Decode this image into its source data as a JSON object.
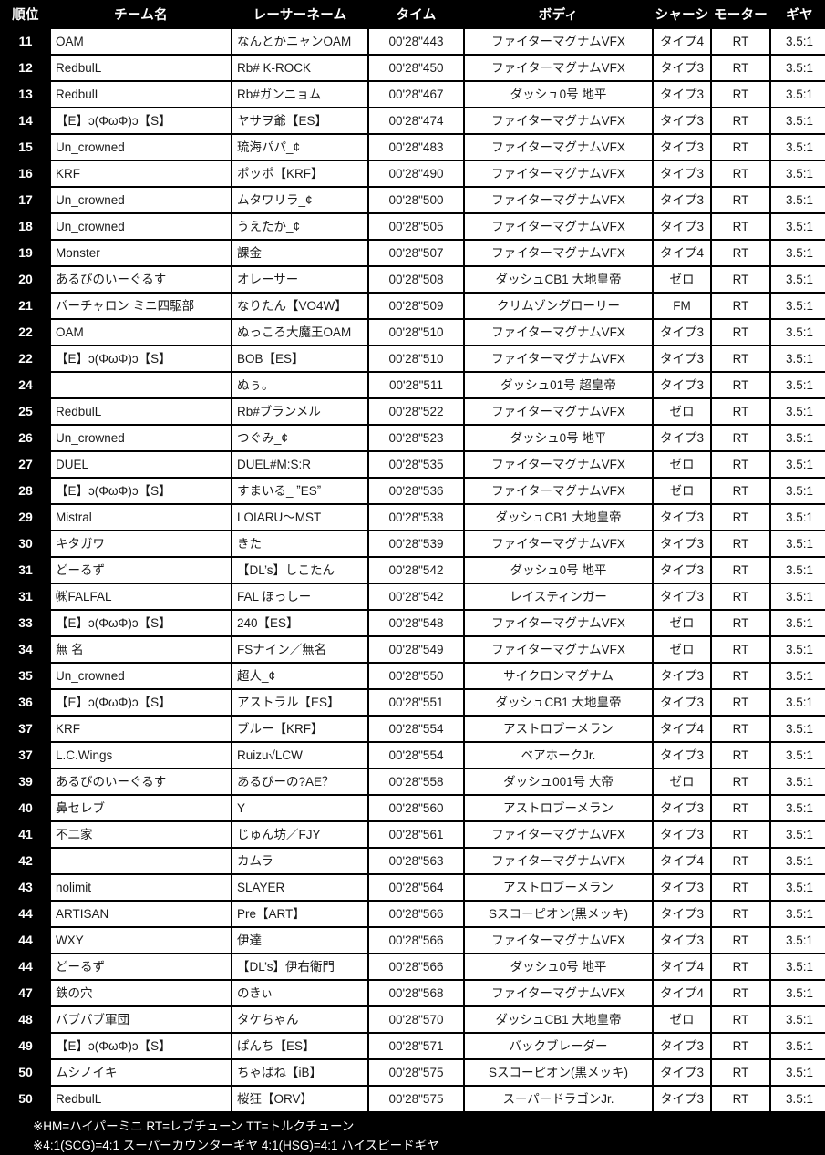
{
  "table": {
    "headers": {
      "rank": "順位",
      "team": "チーム名",
      "racer": "レーサーネーム",
      "time": "タイム",
      "body": "ボディ",
      "chassis": "シャーシ",
      "motor": "モーター",
      "gear": "ギヤ"
    },
    "rows": [
      {
        "rank": "11",
        "team": "OAM",
        "racer": "なんとかニャンOAM",
        "time": "00'28\"443",
        "body": "ファイターマグナムVFX",
        "chassis": "タイプ4",
        "motor": "RT",
        "gear": "3.5:1"
      },
      {
        "rank": "12",
        "team": "RedbulL",
        "racer": "Rb# K-ROCK",
        "time": "00'28\"450",
        "body": "ファイターマグナムVFX",
        "chassis": "タイプ3",
        "motor": "RT",
        "gear": "3.5:1"
      },
      {
        "rank": "13",
        "team": "RedbulL",
        "racer": "Rb#ガンニョム",
        "time": "00'28\"467",
        "body": "ダッシュ0号 地平",
        "chassis": "タイプ3",
        "motor": "RT",
        "gear": "3.5:1"
      },
      {
        "rank": "14",
        "team": "【E】ɔ(ΦωΦ)ɔ【S】",
        "racer": "ヤサヲ爺【ES】",
        "time": "00'28\"474",
        "body": "ファイターマグナムVFX",
        "chassis": "タイプ3",
        "motor": "RT",
        "gear": "3.5:1"
      },
      {
        "rank": "15",
        "team": "Un_crowned",
        "racer": "琉海パパ_¢",
        "time": "00'28\"483",
        "body": "ファイターマグナムVFX",
        "chassis": "タイプ3",
        "motor": "RT",
        "gear": "3.5:1"
      },
      {
        "rank": "16",
        "team": "KRF",
        "racer": "ポッポ【KRF】",
        "time": "00'28\"490",
        "body": "ファイターマグナムVFX",
        "chassis": "タイプ3",
        "motor": "RT",
        "gear": "3.5:1"
      },
      {
        "rank": "17",
        "team": "Un_crowned",
        "racer": "ムタワリラ_¢",
        "time": "00'28\"500",
        "body": "ファイターマグナムVFX",
        "chassis": "タイプ3",
        "motor": "RT",
        "gear": "3.5:1"
      },
      {
        "rank": "18",
        "team": "Un_crowned",
        "racer": "うえたか_¢",
        "time": "00'28\"505",
        "body": "ファイターマグナムVFX",
        "chassis": "タイプ3",
        "motor": "RT",
        "gear": "3.5:1"
      },
      {
        "rank": "19",
        "team": "Monster",
        "racer": "課金",
        "time": "00'28\"507",
        "body": "ファイターマグナムVFX",
        "chassis": "タイプ4",
        "motor": "RT",
        "gear": "3.5:1"
      },
      {
        "rank": "20",
        "team": "あるびのいーぐるす",
        "racer": "オレーサー",
        "time": "00'28\"508",
        "body": "ダッシュCB1 大地皇帝",
        "chassis": "ゼロ",
        "motor": "RT",
        "gear": "3.5:1"
      },
      {
        "rank": "21",
        "team": "バーチャロン ミニ四駆部",
        "racer": "なりたん【VO4W】",
        "time": "00'28\"509",
        "body": "クリムゾングローリー",
        "chassis": "FM",
        "motor": "RT",
        "gear": "3.5:1"
      },
      {
        "rank": "22",
        "team": "OAM",
        "racer": "ぬっころ大魔王OAM",
        "time": "00'28\"510",
        "body": "ファイターマグナムVFX",
        "chassis": "タイプ3",
        "motor": "RT",
        "gear": "3.5:1"
      },
      {
        "rank": "22",
        "team": "【E】ɔ(ΦωΦ)ɔ【S】",
        "racer": "BOB【ES】",
        "time": "00'28\"510",
        "body": "ファイターマグナムVFX",
        "chassis": "タイプ3",
        "motor": "RT",
        "gear": "3.5:1"
      },
      {
        "rank": "24",
        "team": "",
        "racer": "ぬぅ。",
        "time": "00'28\"511",
        "body": "ダッシュ01号 超皇帝",
        "chassis": "タイプ3",
        "motor": "RT",
        "gear": "3.5:1"
      },
      {
        "rank": "25",
        "team": "RedbulL",
        "racer": "Rb#ブランメル",
        "time": "00'28\"522",
        "body": "ファイターマグナムVFX",
        "chassis": "ゼロ",
        "motor": "RT",
        "gear": "3.5:1"
      },
      {
        "rank": "26",
        "team": "Un_crowned",
        "racer": "つぐみ_¢",
        "time": "00'28\"523",
        "body": "ダッシュ0号 地平",
        "chassis": "タイプ3",
        "motor": "RT",
        "gear": "3.5:1"
      },
      {
        "rank": "27",
        "team": "DUEL",
        "racer": "DUEL#M:S:R",
        "time": "00'28\"535",
        "body": "ファイターマグナムVFX",
        "chassis": "ゼロ",
        "motor": "RT",
        "gear": "3.5:1"
      },
      {
        "rank": "28",
        "team": "【E】ɔ(ΦωΦ)ɔ【S】",
        "racer": "すまいる_ ˮESˮ",
        "time": "00'28\"536",
        "body": "ファイターマグナムVFX",
        "chassis": "ゼロ",
        "motor": "RT",
        "gear": "3.5:1"
      },
      {
        "rank": "29",
        "team": "Mistral",
        "racer": "LOIARU〜MST",
        "time": "00'28\"538",
        "body": "ダッシュCB1 大地皇帝",
        "chassis": "タイプ3",
        "motor": "RT",
        "gear": "3.5:1"
      },
      {
        "rank": "30",
        "team": "キタガワ",
        "racer": "きた",
        "time": "00'28\"539",
        "body": "ファイターマグナムVFX",
        "chassis": "タイプ3",
        "motor": "RT",
        "gear": "3.5:1"
      },
      {
        "rank": "31",
        "team": "どーるず",
        "racer": "【DL’s】しこたん",
        "time": "00'28\"542",
        "body": "ダッシュ0号 地平",
        "chassis": "タイプ3",
        "motor": "RT",
        "gear": "3.5:1"
      },
      {
        "rank": "31",
        "team": "㈱FALFAL",
        "racer": "FAL ほっしー",
        "time": "00'28\"542",
        "body": "レイスティンガー",
        "chassis": "タイプ3",
        "motor": "RT",
        "gear": "3.5:1"
      },
      {
        "rank": "33",
        "team": "【E】ɔ(ΦωΦ)ɔ【S】",
        "racer": "240【ES】",
        "time": "00'28\"548",
        "body": "ファイターマグナムVFX",
        "chassis": "ゼロ",
        "motor": "RT",
        "gear": "3.5:1"
      },
      {
        "rank": "34",
        "team": "無 名",
        "racer": "FSナイン／無名",
        "time": "00'28\"549",
        "body": "ファイターマグナムVFX",
        "chassis": "ゼロ",
        "motor": "RT",
        "gear": "3.5:1"
      },
      {
        "rank": "35",
        "team": "Un_crowned",
        "racer": "超人_¢",
        "time": "00'28\"550",
        "body": "サイクロンマグナム",
        "chassis": "タイプ3",
        "motor": "RT",
        "gear": "3.5:1"
      },
      {
        "rank": "36",
        "team": "【E】ɔ(ΦωΦ)ɔ【S】",
        "racer": "アストラル【ES】",
        "time": "00'28\"551",
        "body": "ダッシュCB1 大地皇帝",
        "chassis": "タイプ3",
        "motor": "RT",
        "gear": "3.5:1"
      },
      {
        "rank": "37",
        "team": "KRF",
        "racer": "ブルー【KRF】",
        "time": "00'28\"554",
        "body": "アストロブーメラン",
        "chassis": "タイプ4",
        "motor": "RT",
        "gear": "3.5:1"
      },
      {
        "rank": "37",
        "team": "L.C.Wings",
        "racer": "Ruizu√LCW",
        "time": "00'28\"554",
        "body": "ベアホークJr.",
        "chassis": "タイプ3",
        "motor": "RT",
        "gear": "3.5:1"
      },
      {
        "rank": "39",
        "team": "あるびのいーぐるす",
        "racer": "あるびーの?AE？",
        "time": "00'28\"558",
        "body": "ダッシュ001号 大帝",
        "chassis": "ゼロ",
        "motor": "RT",
        "gear": "3.5:1"
      },
      {
        "rank": "40",
        "team": "鼻セレブ",
        "racer": "Y",
        "time": "00'28\"560",
        "body": "アストロブーメラン",
        "chassis": "タイプ3",
        "motor": "RT",
        "gear": "3.5:1"
      },
      {
        "rank": "41",
        "team": "不二家",
        "racer": "じゅん坊／FJY",
        "time": "00'28\"561",
        "body": "ファイターマグナムVFX",
        "chassis": "タイプ3",
        "motor": "RT",
        "gear": "3.5:1"
      },
      {
        "rank": "42",
        "team": "",
        "racer": "カムラ",
        "time": "00'28\"563",
        "body": "ファイターマグナムVFX",
        "chassis": "タイプ4",
        "motor": "RT",
        "gear": "3.5:1"
      },
      {
        "rank": "43",
        "team": "nolimit",
        "racer": "SLAYER",
        "time": "00'28\"564",
        "body": "アストロブーメラン",
        "chassis": "タイプ3",
        "motor": "RT",
        "gear": "3.5:1"
      },
      {
        "rank": "44",
        "team": "ARTISAN",
        "racer": "Pre【ART】",
        "time": "00'28\"566",
        "body": "Sスコーピオン(黒メッキ)",
        "chassis": "タイプ3",
        "motor": "RT",
        "gear": "3.5:1"
      },
      {
        "rank": "44",
        "team": "WXY",
        "racer": "伊達",
        "time": "00'28\"566",
        "body": "ファイターマグナムVFX",
        "chassis": "タイプ3",
        "motor": "RT",
        "gear": "3.5:1"
      },
      {
        "rank": "44",
        "team": "どーるず",
        "racer": "【DL’s】伊右衛門",
        "time": "00'28\"566",
        "body": "ダッシュ0号 地平",
        "chassis": "タイプ4",
        "motor": "RT",
        "gear": "3.5:1"
      },
      {
        "rank": "47",
        "team": "鉄の穴",
        "racer": "のきぃ",
        "time": "00'28\"568",
        "body": "ファイターマグナムVFX",
        "chassis": "タイプ4",
        "motor": "RT",
        "gear": "3.5:1"
      },
      {
        "rank": "48",
        "team": "バブバブ軍団",
        "racer": "タケちゃん",
        "time": "00'28\"570",
        "body": "ダッシュCB1 大地皇帝",
        "chassis": "ゼロ",
        "motor": "RT",
        "gear": "3.5:1"
      },
      {
        "rank": "49",
        "team": "【E】ɔ(ΦωΦ)ɔ【S】",
        "racer": "ぱんち【ES】",
        "time": "00'28\"571",
        "body": "バックブレーダー",
        "chassis": "タイプ3",
        "motor": "RT",
        "gear": "3.5:1"
      },
      {
        "rank": "50",
        "team": "ムシノイキ",
        "racer": "ちゃばね【iB】",
        "time": "00'28\"575",
        "body": "Sスコーピオン(黒メッキ)",
        "chassis": "タイプ3",
        "motor": "RT",
        "gear": "3.5:1"
      },
      {
        "rank": "50",
        "team": "RedbulL",
        "racer": "桜狂【ORV】",
        "time": "00'28\"575",
        "body": "スーパードラゴンJr.",
        "chassis": "タイプ3",
        "motor": "RT",
        "gear": "3.5:1"
      }
    ]
  },
  "notes": {
    "line1": "※HM=ハイパーミニ  RT=レブチューン  TT=トルクチューン",
    "line2": "※4:1(SCG)=4:1 スーパーカウンターギヤ  4:1(HSG)=4:1 ハイスピードギヤ"
  },
  "colors": {
    "background": "#000000",
    "cell_background": "#ffffff",
    "text": "#1a1a1a",
    "header_text": "#ffffff"
  }
}
